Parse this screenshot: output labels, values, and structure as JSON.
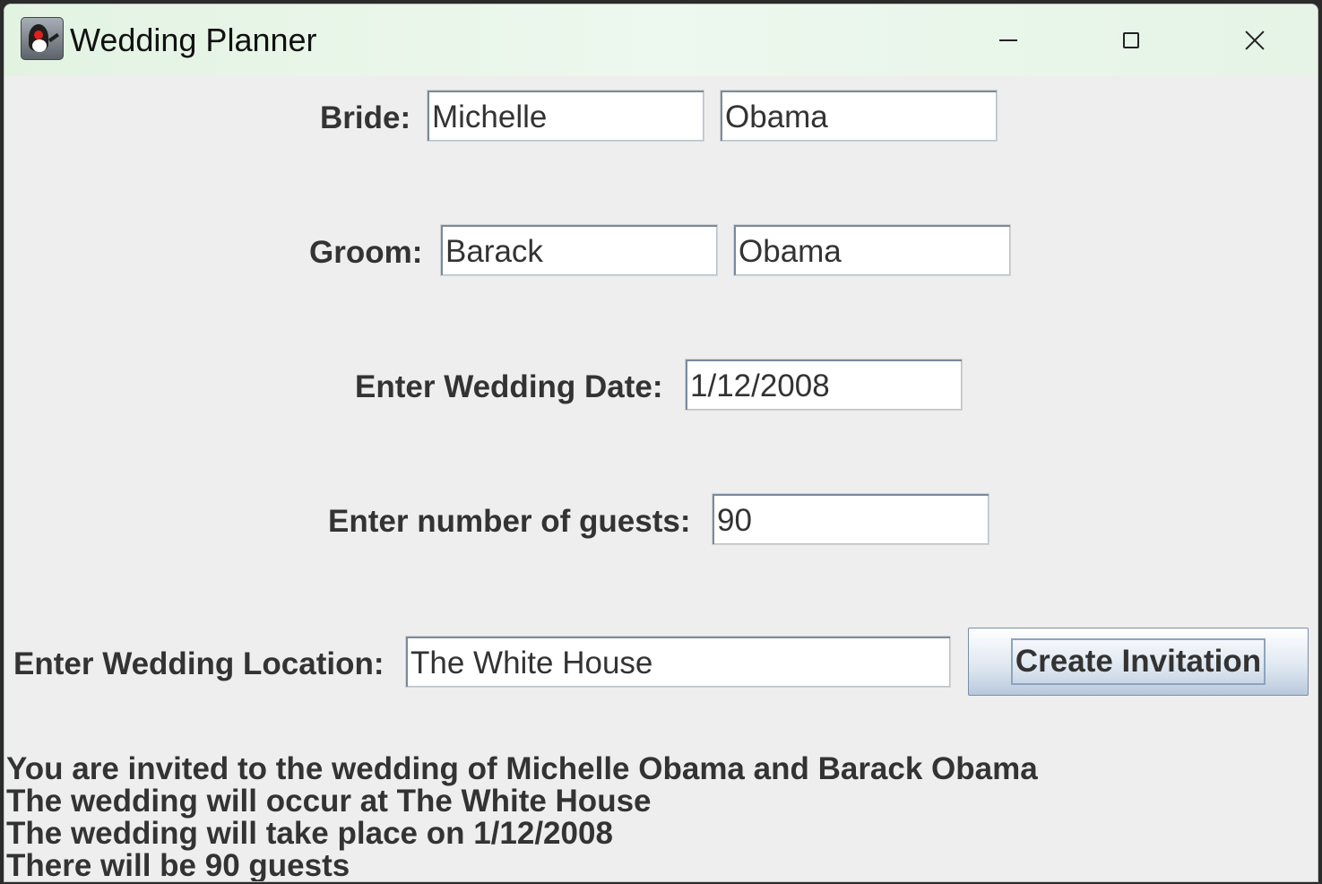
{
  "window": {
    "title": "Wedding Planner",
    "icon": "java-duke-icon"
  },
  "titlebar": {
    "minimize_icon": "minimize-icon",
    "maximize_icon": "maximize-icon",
    "close_icon": "close-icon"
  },
  "form": {
    "bride": {
      "label": "Bride:",
      "first": "Michelle",
      "last": "Obama"
    },
    "groom": {
      "label": "Groom:",
      "first": "Barack",
      "last": "Obama"
    },
    "date": {
      "label": "Enter Wedding Date:",
      "value": "1/12/2008"
    },
    "guests": {
      "label": "Enter number of guests:",
      "value": "90"
    },
    "location": {
      "label": "Enter Wedding Location:",
      "value": "The White House"
    },
    "create_button": "Create Invitation"
  },
  "output": {
    "lines": [
      "You are invited to the wedding of Michelle  Obama and Barack Obama",
      "The wedding will occur at The White House",
      "The wedding will take place on 1/12/2008",
      "There will be 90 guests"
    ]
  },
  "colors": {
    "window_bg": "#eeeeee",
    "titlebar_bg": "#e8f6e8",
    "label_text": "#333333",
    "button_gradient_bottom": "#b8c9dd"
  }
}
